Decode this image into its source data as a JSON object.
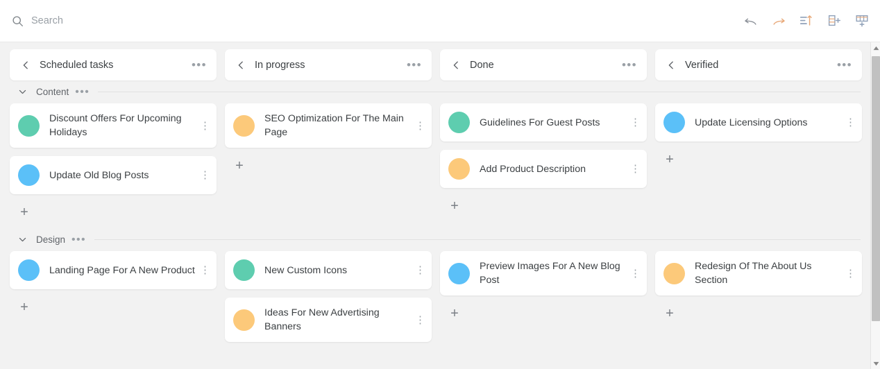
{
  "search": {
    "placeholder": "Search",
    "value": "",
    "icon": "search-icon"
  },
  "toolbar": {
    "buttons": [
      {
        "name": "undo-icon",
        "label": "Undo"
      },
      {
        "name": "redo-icon",
        "label": "Redo"
      },
      {
        "name": "sort-icon",
        "label": "Sort"
      },
      {
        "name": "add-column-icon",
        "label": "Add column"
      },
      {
        "name": "add-row-icon",
        "label": "Add row"
      }
    ]
  },
  "board": {
    "columns": [
      {
        "title": "Scheduled tasks",
        "menu": "•••"
      },
      {
        "title": "In progress",
        "menu": "•••"
      },
      {
        "title": "Done",
        "menu": "•••"
      },
      {
        "title": "Verified",
        "menu": "•••"
      }
    ],
    "add_card_glyph": "+",
    "card_menu_glyph": "⋮",
    "group_menu_glyph": "•••",
    "colors": {
      "green": "#5ecdaf",
      "blue": "#5bc0f8",
      "yellow": "#fcc97a",
      "background": "#f2f2f2",
      "card": "#ffffff",
      "text": "#3c4043"
    },
    "groups": [
      {
        "name": "Content",
        "lanes": [
          {
            "cards": [
              {
                "title": "Discount Offers For Upcoming Holidays",
                "color": "green"
              },
              {
                "title": "Update Old Blog Posts",
                "color": "blue"
              }
            ]
          },
          {
            "cards": [
              {
                "title": "SEO Optimization For The Main Page",
                "color": "yellow"
              }
            ]
          },
          {
            "cards": [
              {
                "title": "Guidelines For Guest Posts",
                "color": "green"
              },
              {
                "title": "Add Product Description",
                "color": "yellow"
              }
            ]
          },
          {
            "cards": [
              {
                "title": "Update Licensing Options",
                "color": "blue"
              }
            ]
          }
        ]
      },
      {
        "name": "Design",
        "lanes": [
          {
            "cards": [
              {
                "title": "Landing Page For A New Product",
                "color": "blue"
              }
            ]
          },
          {
            "cards": [
              {
                "title": "New Custom Icons",
                "color": "green"
              },
              {
                "title": "Ideas For New Advertising Banners",
                "color": "yellow"
              }
            ]
          },
          {
            "cards": [
              {
                "title": "Preview Images For A New Blog Post",
                "color": "blue"
              }
            ]
          },
          {
            "cards": [
              {
                "title": "Redesign Of The About Us Section",
                "color": "yellow"
              }
            ]
          }
        ]
      }
    ]
  },
  "scrollbar": {
    "up": "▲",
    "down": "▼"
  }
}
